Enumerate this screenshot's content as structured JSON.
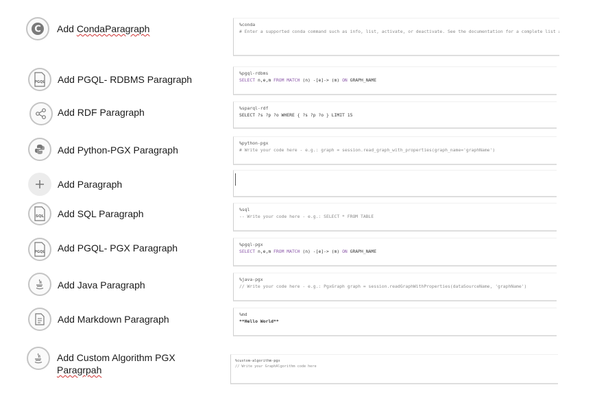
{
  "rows": [
    {
      "label_prefix": "Add ",
      "label_link": "CondaParagraph",
      "icon": "conda-icon",
      "icon_letter": "C",
      "code_line1": "%conda",
      "code_line2": "# Enter a supported conda command such as info, list, activate, or deactivate. See the documentation for a complete list and usage details."
    },
    {
      "label": "Add  PGQL- RDBMS Paragraph",
      "icon": "pgql-icon",
      "icon_letter": "PGQL",
      "code_line1": "%pgql-rdbms"
    },
    {
      "label": "Add RDF Paragraph",
      "icon": "share-graph-icon",
      "code_line1": "%sparql-rdf",
      "code_line2": "SELECT ?s ?p ?o WHERE { ?s ?p ?o } LIMIT 15"
    },
    {
      "label": "Add Python-PGX Paragraph",
      "icon": "python-icon",
      "code_line1": "%python-pgx",
      "code_line2": "# Write your code here - e.g.: graph = session.read_graph_with_properties(graph_name='graphName')"
    },
    {
      "label": "Add Paragraph",
      "icon": "plus-icon"
    },
    {
      "label": "Add  SQL Paragraph",
      "icon": "sql-icon",
      "icon_letter": "SQL",
      "code_line1": "%sql",
      "code_line2": "-- Write your code here - e.g.: SELECT * FROM TABLE"
    },
    {
      "label": "Add  PGQL- PGX Paragraph",
      "icon": "pgql-icon",
      "icon_letter": "PGQL",
      "code_line1": "%pgql-pgx"
    },
    {
      "label": "Add  Java Paragraph",
      "icon": "java-icon",
      "code_line1": "%java-pgx",
      "code_line2": "// Write your code here - e.g.: PgxGraph graph = session.readGraphWithProperties(dataSourceName, 'graphName')"
    },
    {
      "label": "Add  Markdown Paragraph",
      "icon": "markdown-icon",
      "code_line1": "%md",
      "code_line2": "**Hello World**"
    },
    {
      "label_line1": "Add  Custom Algorithm PGX",
      "label_line2": "Paragrpah",
      "icon": "java-icon",
      "code_line1": "%custom-algorithm-pgx",
      "code_line2": "// Write your GraphAlgorithm code here"
    }
  ],
  "pgql_query": {
    "select": "SELECT",
    "vars": " n,e,m ",
    "from": "FROM",
    "match": " MATCH",
    "pattern": " (n) -[e]-> (m) ",
    "on": "ON",
    "graph": " GRAPH_NAME"
  },
  "colors": {
    "keyword": "#8a56a8",
    "spellcheck": "#d03030",
    "icon_border": "#c4c4c4"
  }
}
